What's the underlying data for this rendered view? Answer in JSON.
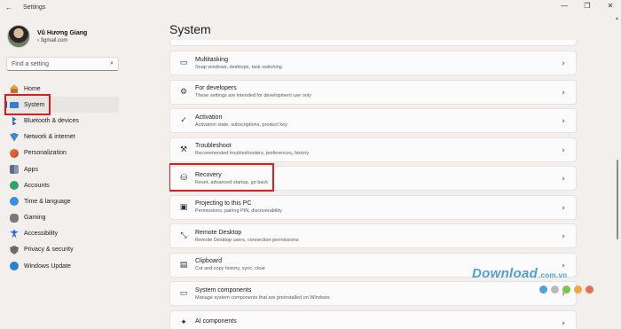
{
  "window": {
    "back_icon": "←",
    "title": "Settings",
    "controls": [
      "—",
      "❐",
      "✕"
    ]
  },
  "profile": {
    "name": "Vũ Hương Giang",
    "email": "›          3gmail.com"
  },
  "search": {
    "placeholder": "Find a setting",
    "icon": "⌕"
  },
  "sidebar": {
    "items": [
      {
        "label": "Home",
        "icon": "home-icon"
      },
      {
        "label": "System",
        "icon": "system-icon",
        "active": true
      },
      {
        "label": "Bluetooth & devices",
        "icon": "bluetooth-icon"
      },
      {
        "label": "Network & internet",
        "icon": "network-icon"
      },
      {
        "label": "Personalization",
        "icon": "personalization-icon"
      },
      {
        "label": "Apps",
        "icon": "apps-icon"
      },
      {
        "label": "Accounts",
        "icon": "accounts-icon"
      },
      {
        "label": "Time & language",
        "icon": "time-icon"
      },
      {
        "label": "Gaming",
        "icon": "gaming-icon"
      },
      {
        "label": "Accessibility",
        "icon": "accessibility-icon"
      },
      {
        "label": "Privacy & security",
        "icon": "privacy-icon"
      },
      {
        "label": "Windows Update",
        "icon": "windows-update-icon"
      }
    ]
  },
  "main": {
    "title": "System",
    "chevron": "›",
    "cards": [
      {
        "title": "Multitasking",
        "desc": "Snap windows, desktops, task switching",
        "icon": "multitasking-icon",
        "glyph": "▭"
      },
      {
        "title": "For developers",
        "desc": "These settings are intended for development use only",
        "icon": "developers-icon",
        "glyph": "⚙"
      },
      {
        "title": "Activation",
        "desc": "Activation state, subscriptions, product key",
        "icon": "activation-icon",
        "glyph": "✓"
      },
      {
        "title": "Troubleshoot",
        "desc": "Recommended troubleshooters, preferences, history",
        "icon": "wrench-icon",
        "glyph": "⚒"
      },
      {
        "title": "Recovery",
        "desc": "Reset, advanced startup, go back",
        "icon": "recovery-icon",
        "glyph": "⛁"
      },
      {
        "title": "Projecting to this PC",
        "desc": "Permissions, pairing PIN, discoverability",
        "icon": "projecting-icon",
        "glyph": "▣"
      },
      {
        "title": "Remote Desktop",
        "desc": "Remote Desktop users, connection permissions",
        "icon": "remote-desktop-icon",
        "glyph": "⤡"
      },
      {
        "title": "Clipboard",
        "desc": "Cut and copy history, sync, clear",
        "icon": "clipboard-icon",
        "glyph": "▤"
      },
      {
        "title": "System components",
        "desc": "Manage system components that are preinstalled on Windows",
        "icon": "system-components-icon",
        "glyph": "▭"
      },
      {
        "title": "AI components",
        "desc": "",
        "icon": "ai-components-icon",
        "glyph": "✦"
      }
    ]
  },
  "watermark": {
    "text": "Download",
    "suffix": ".com.vn",
    "colors": [
      "#4aa3e0",
      "#b9b9b9",
      "#7dc24b",
      "#f2a93b",
      "#e26d5a"
    ]
  }
}
